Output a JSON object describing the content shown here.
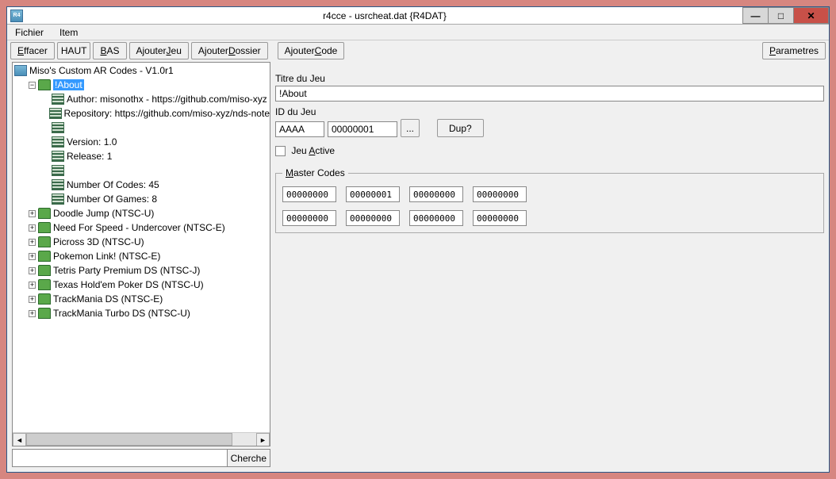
{
  "titlebar": {
    "icon_text": "R4",
    "title": "r4cce - usrcheat.dat {R4DAT}"
  },
  "menubar": {
    "file": "Fichier",
    "item": "Item"
  },
  "toolbar": {
    "erase": {
      "pre": "",
      "ul": "E",
      "post": "ffacer"
    },
    "up": "HAUT",
    "down": {
      "pre": "",
      "ul": "B",
      "post": "AS"
    },
    "add_game": {
      "pre": "Ajouter ",
      "ul": "J",
      "post": "eu"
    },
    "add_folder": {
      "pre": "Ajouter ",
      "ul": "D",
      "post": "ossier"
    },
    "add_code": {
      "pre": "Ajouter ",
      "ul": "C",
      "post": "ode"
    },
    "params": {
      "pre": "",
      "ul": "P",
      "post": "arametres"
    }
  },
  "tree": {
    "root": "Miso's Custom AR Codes - V1.0r1",
    "about": "!About",
    "about_children": [
      "Author: misonothx - https://github.com/miso-xyz",
      "Repository: https://github.com/miso-xyz/nds-note",
      "",
      "Version: 1.0",
      "Release: 1",
      "",
      "Number Of Codes: 45",
      "Number Of Games: 8"
    ],
    "games": [
      "Doodle Jump (NTSC-U)",
      "Need For Speed - Undercover (NTSC-E)",
      "Picross 3D (NTSC-U)",
      "Pokemon Link! (NTSC-E)",
      "Tetris Party Premium DS (NTSC-J)",
      "Texas Hold'em Poker DS (NTSC-U)",
      "TrackMania DS (NTSC-E)",
      "TrackMania Turbo DS (NTSC-U)"
    ]
  },
  "search_btn": "Cherche",
  "right": {
    "title_label": "Titre du Jeu",
    "title_value": "!About",
    "id_label": "ID du Jeu",
    "id1": "AAAA",
    "id2": "00000001",
    "browse": "...",
    "dup": "Dup?",
    "active_label_pre": "Jeu ",
    "active_label_ul": "A",
    "active_label_post": "ctive",
    "master_label_pre": "",
    "master_label_ul": "M",
    "master_label_post": "aster Codes",
    "codes_row1": [
      "00000000",
      "00000001",
      "00000000",
      "00000000"
    ],
    "codes_row2": [
      "00000000",
      "00000000",
      "00000000",
      "00000000"
    ]
  }
}
